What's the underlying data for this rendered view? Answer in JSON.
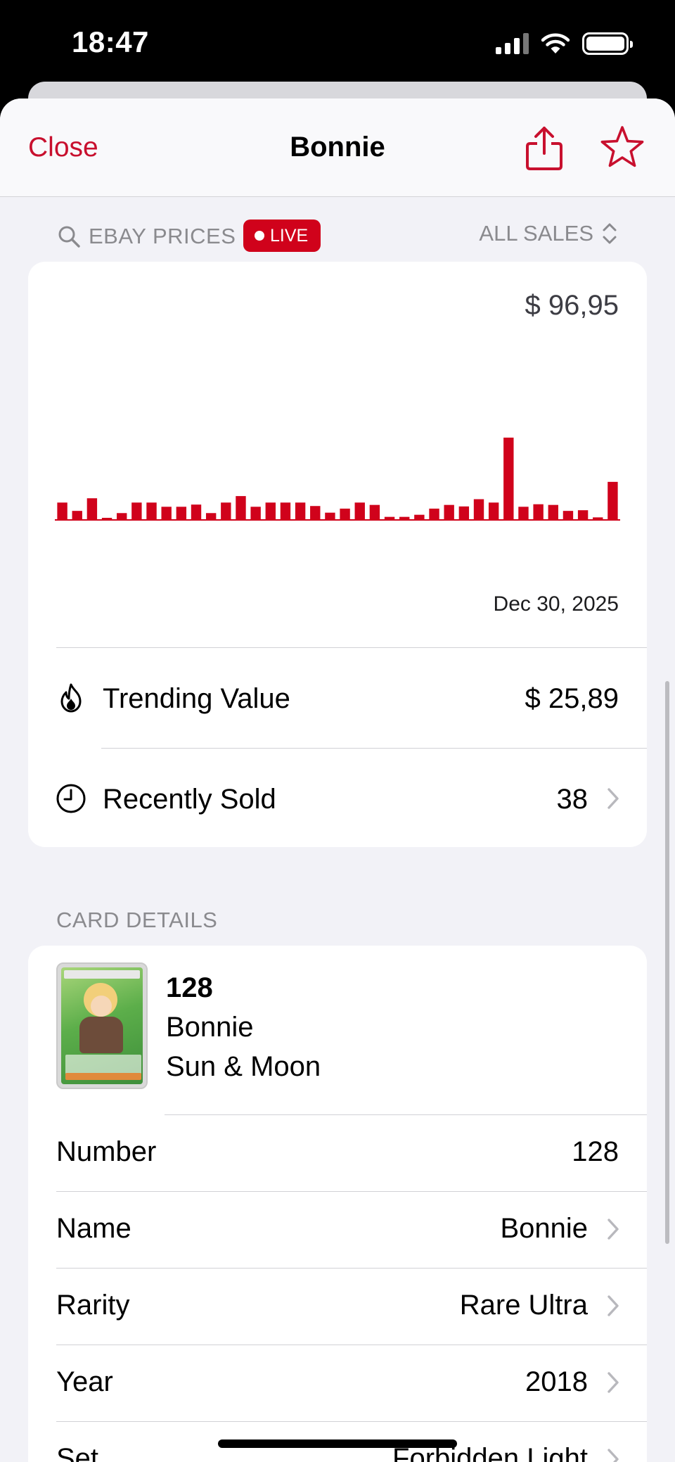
{
  "status_bar": {
    "time": "18:47"
  },
  "nav": {
    "close_label": "Close",
    "title": "Bonnie",
    "share_icon": "share-icon",
    "favorite_icon": "star-icon"
  },
  "prices": {
    "source_label": "EBAY PRICES",
    "live_label": "LIVE",
    "filter_label": "ALL SALES",
    "max_price": "$ 96,95",
    "end_date": "Dec 30, 2025",
    "trending_label": "Trending Value",
    "trending_value": "$ 25,89",
    "recent_label": "Recently Sold",
    "recent_value": "38"
  },
  "chart_data": {
    "type": "bar",
    "x_end_label": "Dec 30, 2025",
    "ylim": [
      0,
      96.95
    ],
    "values": [
      19.8,
      9.9,
      24.9,
      0.8,
      7.3,
      19.8,
      19.8,
      14.8,
      14.8,
      17.4,
      7.3,
      19.8,
      27.5,
      14.8,
      19.8,
      19.8,
      19.8,
      15.7,
      7.8,
      12.6,
      19.8,
      17.0,
      2.8,
      2.8,
      5.3,
      12.6,
      17.0,
      15.2,
      23.8,
      19.8,
      96.95,
      14.8,
      17.8,
      17.0,
      9.9,
      10.7,
      2.2,
      44.4
    ],
    "color": "#d0021b"
  },
  "details": {
    "section_title": "CARD DETAILS",
    "summary": {
      "number": "128",
      "name": "Bonnie",
      "set": "Sun & Moon"
    },
    "rows": [
      {
        "label": "Number",
        "value": "128"
      },
      {
        "label": "Name",
        "value": "Bonnie"
      },
      {
        "label": "Rarity",
        "value": "Rare Ultra"
      },
      {
        "label": "Year",
        "value": "2018"
      },
      {
        "label": "Set",
        "value": "Forbidden Light"
      }
    ]
  },
  "colors": {
    "accent": "#c8102e",
    "live": "#d0021b",
    "background": "#f2f2f7"
  }
}
